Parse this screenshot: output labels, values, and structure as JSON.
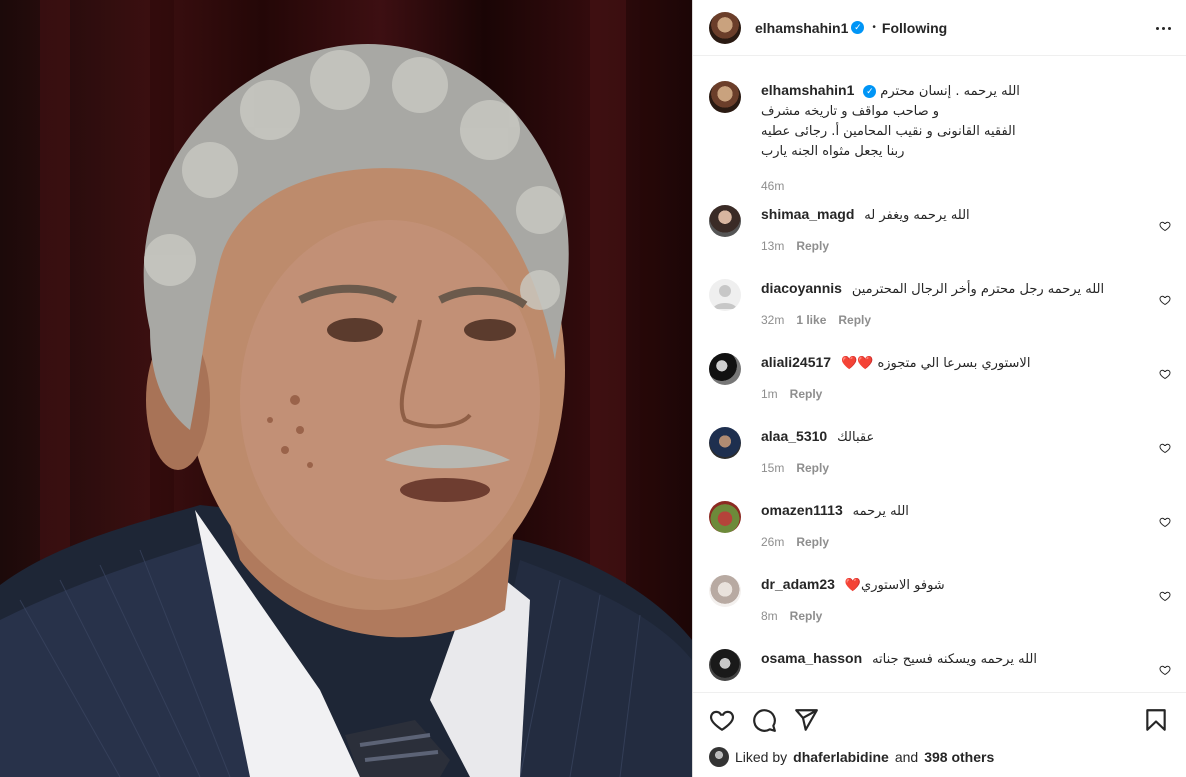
{
  "post": {
    "owner": "elhamshahin1",
    "following_label": "Following",
    "separator": "•"
  },
  "caption": {
    "username": "elhamshahin1",
    "lines": [
      "الله يرحمه . إنسان محترم",
      "و صاحب مواقف و تاريخه مشرف",
      "الفقيه القانونى و نقيب المحامين أ. رجائى عطيه",
      "ربنا يجعل مثواه الجنه يارب"
    ],
    "time": "46m"
  },
  "comments": [
    {
      "username": "shimaa_magd",
      "text": "الله يرحمه ويغفر له",
      "time": "13m",
      "likes": "",
      "reply": "Reply"
    },
    {
      "username": "diacoyannis",
      "text": "الله يرحمه رجل محترم وأخر الرجال المحترمين",
      "time": "32m",
      "likes": "1 like",
      "reply": "Reply"
    },
    {
      "username": "aliali24517",
      "text": "الاستوري بسرعا الي متجوزه ❤️❤️",
      "time": "1m",
      "likes": "",
      "reply": "Reply"
    },
    {
      "username": "alaa_5310",
      "text": "عقبالك",
      "time": "15m",
      "likes": "",
      "reply": "Reply"
    },
    {
      "username": "omazen1113",
      "text": "الله يرحمه",
      "time": "26m",
      "likes": "",
      "reply": "Reply"
    },
    {
      "username": "dr_adam23",
      "text": "شوفو الاستوري❤️",
      "time": "8m",
      "likes": "",
      "reply": "Reply"
    },
    {
      "username": "osama_hasson",
      "text": "الله يرحمه ويسكنه فسيح جناته",
      "time": "",
      "likes": "",
      "reply": ""
    }
  ],
  "likes": {
    "prefix": "Liked by",
    "user": "dhaferlabidine",
    "connector": "and",
    "others": "398 others"
  },
  "icons": {
    "more": "more-options-icon",
    "like": "heart-icon",
    "comment": "comment-icon",
    "share": "share-icon",
    "save": "bookmark-icon",
    "verified": "verified-badge-icon"
  },
  "colors": {
    "accent": "#0095f6",
    "text": "#262626",
    "muted": "#8e8e8e",
    "heart_red": "#ed4956"
  }
}
